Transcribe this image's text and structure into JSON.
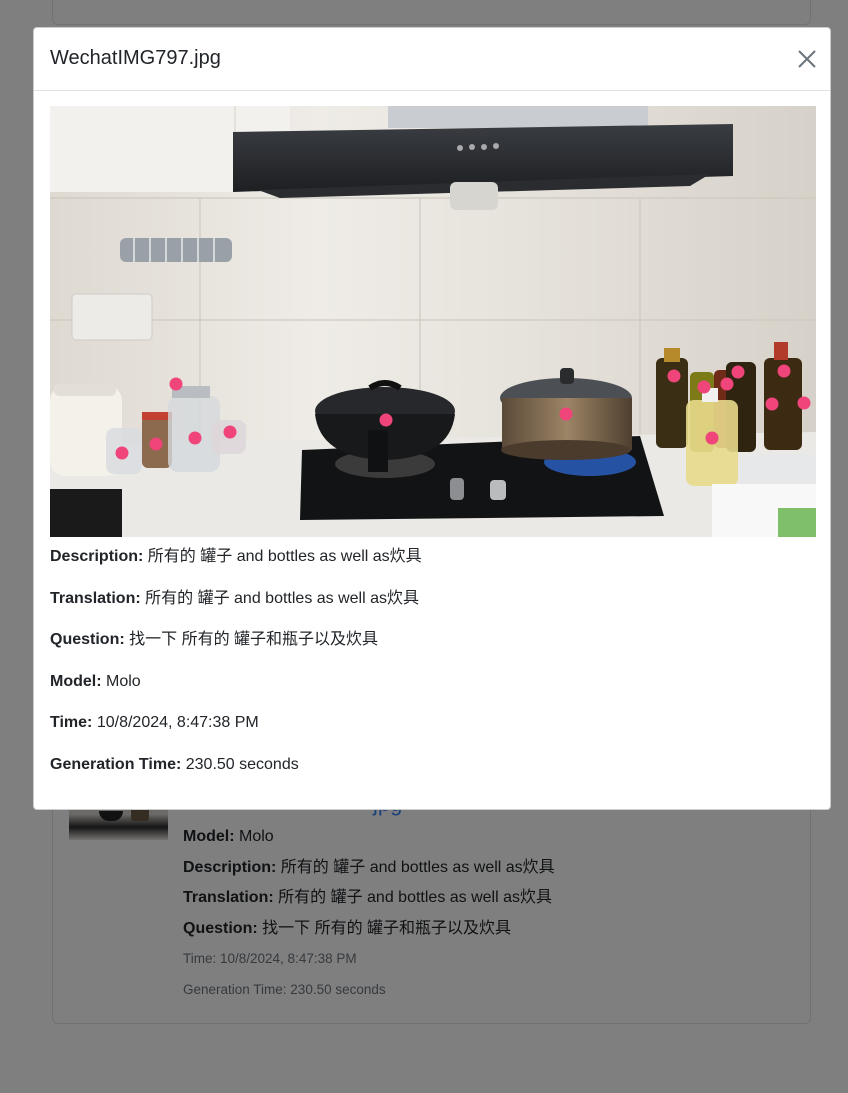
{
  "modal": {
    "title": "WechatIMG797.jpg",
    "close_label": "×",
    "photo_alt": "WechatIMG797.jpg",
    "marker_color": "#f0457a",
    "details": [
      {
        "label": "Description:",
        "value": "所有的 罐子 and bottles as well as炊具"
      },
      {
        "label": "Translation:",
        "value": "所有的 罐子 and bottles as well as炊具"
      },
      {
        "label": "Question:",
        "value": "找一下 所有的 罐子和瓶子以及炊具"
      },
      {
        "label": "Model:",
        "value": "Molo"
      },
      {
        "label": "Time:",
        "value": "10/8/2024, 8:47:38 PM"
      },
      {
        "label": "Generation Time:",
        "value": "230.50 seconds"
      }
    ]
  },
  "background_card": {
    "title_fragment": "jpg",
    "model_label": "Model:",
    "model_value": "Molo",
    "description_label": "Description:",
    "description_value": "所有的 罐子 and bottles as well as炊具",
    "translation_label": "Translation:",
    "translation_value": "所有的 罐子 and bottles as well as炊具",
    "question_label": "Question:",
    "question_value": "找一下 所有的 罐子和瓶子以及炊具",
    "time_text": "Time: 10/8/2024, 8:47:38 PM",
    "generation_text": "Generation Time: 230.50 seconds"
  }
}
